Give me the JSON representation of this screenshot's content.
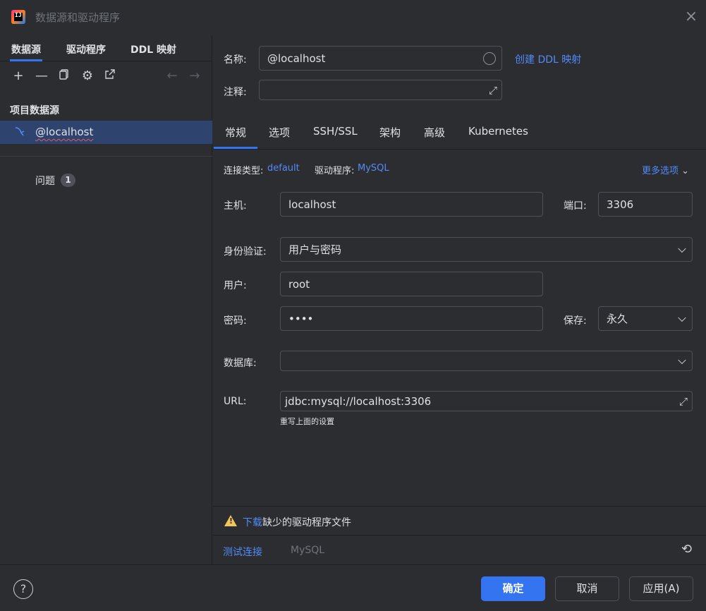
{
  "window": {
    "title": "数据源和驱动程序",
    "close_icon": "close-icon"
  },
  "sidebar": {
    "tabs": [
      {
        "label": "数据源"
      },
      {
        "label": "驱动程序"
      },
      {
        "label": "DDL 映射"
      }
    ],
    "section_title": "项目数据源",
    "datasource": "@localhost",
    "problems_label": "问题",
    "problems_count": "1"
  },
  "form": {
    "name_label": "名称:",
    "name_value": "@localhost",
    "create_ddl_link": "创建 DDL 映射",
    "comment_label": "注释:",
    "comment_value": ""
  },
  "tabs": [
    {
      "label": "常规"
    },
    {
      "label": "选项"
    },
    {
      "label": "SSH/SSL"
    },
    {
      "label": "架构"
    },
    {
      "label": "高级"
    },
    {
      "label": "Kubernetes"
    }
  ],
  "general": {
    "conn_type_label": "连接类型:",
    "conn_type_value": "default",
    "driver_label": "驱动程序:",
    "driver_value": "MySQL",
    "more_options": "更多选项",
    "host_label": "主机:",
    "host_value": "localhost",
    "port_label": "端口:",
    "port_value": "3306",
    "auth_label": "身份验证:",
    "auth_value": "用户与密码",
    "user_label": "用户:",
    "user_value": "root",
    "password_label": "密码:",
    "password_value": "••••",
    "save_label": "保存:",
    "save_value": "永久",
    "database_label": "数据库:",
    "database_value": "",
    "url_label": "URL:",
    "url_value": "jdbc:mysql://localhost:3306",
    "url_hint": "重写上面的设置"
  },
  "warning": {
    "download_link": "下载",
    "text": "缺少的驱动程序文件"
  },
  "bottom_bar": {
    "test_connection": "测试连接",
    "driver_name": "MySQL"
  },
  "footer": {
    "help": "?",
    "ok": "确定",
    "cancel": "取消",
    "apply": "应用(A)"
  },
  "colors": {
    "accent": "#3574f0",
    "link": "#548af7",
    "background": "#2b2d30",
    "selection": "#2e436e",
    "warning": "#f2c55c"
  }
}
